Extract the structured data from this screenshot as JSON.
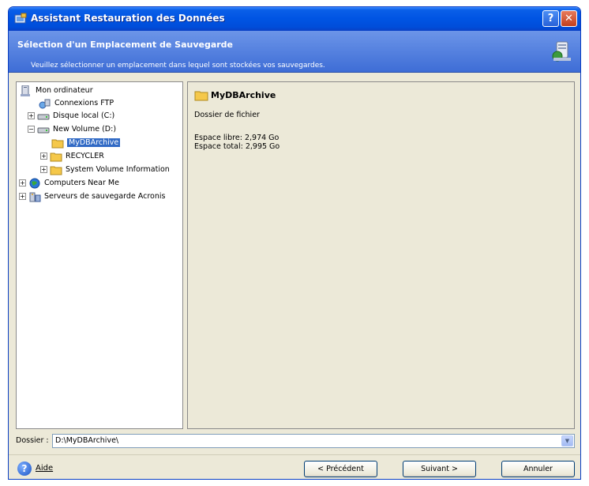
{
  "window": {
    "title": "Assistant Restauration des Données"
  },
  "header": {
    "title": "Sélection d'un Emplacement de Sauvegarde",
    "subtitle": "Veuillez sélectionner un emplacement dans lequel sont stockées vos sauvegardes."
  },
  "tree": {
    "items": [
      {
        "label": "Mon ordinateur",
        "icon": "computer-icon"
      },
      {
        "label": "Connexions FTP",
        "icon": "ftp-icon"
      },
      {
        "label": "Disque local (C:)",
        "icon": "drive-icon",
        "expander": "+"
      },
      {
        "label": "New Volume (D:)",
        "icon": "drive-icon",
        "expander": "−"
      },
      {
        "label": "MyDBArchive",
        "icon": "folder-icon",
        "selected": true
      },
      {
        "label": "RECYCLER",
        "icon": "folder-icon",
        "expander": "+"
      },
      {
        "label": "System Volume Information",
        "icon": "folder-icon",
        "expander": "+"
      },
      {
        "label": "Computers Near Me",
        "icon": "network-globe-icon",
        "expander": "+"
      },
      {
        "label": "Serveurs de sauvegarde Acronis",
        "icon": "backup-server-icon",
        "expander": "+"
      }
    ]
  },
  "details": {
    "name": "MyDBArchive",
    "type": "Dossier de fichier",
    "free_space": "Espace libre: 2,974 Go",
    "total_space": "Espace total: 2,995 Go"
  },
  "folder": {
    "label": "Dossier :",
    "value": "D:\\MyDBArchive\\"
  },
  "footer": {
    "help_label": "Aide",
    "prev_label": "< Précédent",
    "next_label": "Suivant >",
    "cancel_label": "Annuler"
  },
  "colors": {
    "titlebar": "#0054e3",
    "header": "#4a78dc",
    "selection": "#316ac5",
    "folder": "#f5c84a"
  }
}
